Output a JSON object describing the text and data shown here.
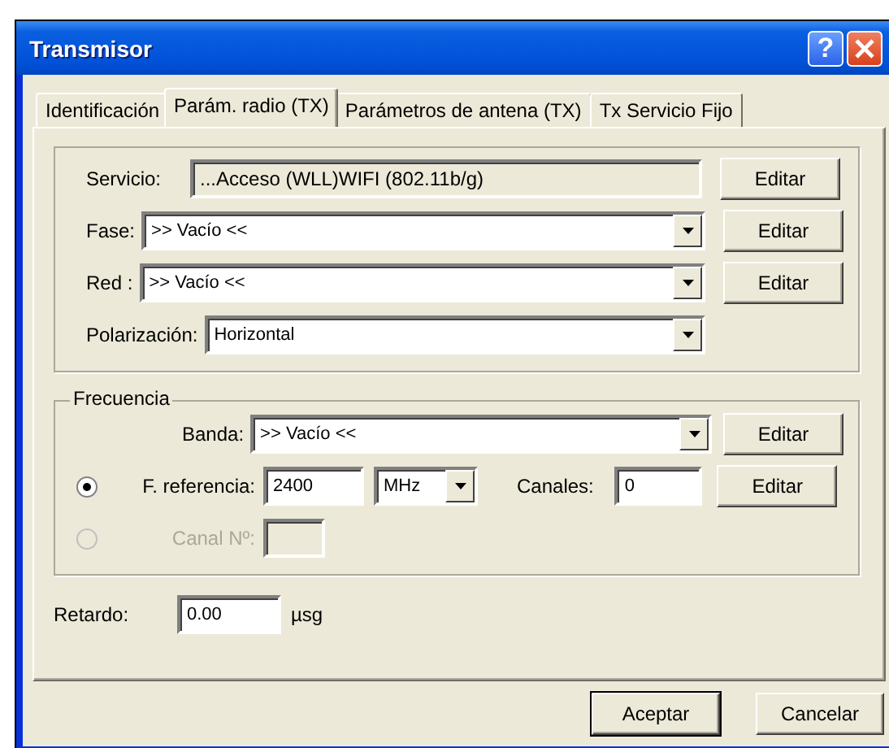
{
  "window": {
    "title": "Transmisor",
    "help": "?"
  },
  "tabs": [
    {
      "label": "Identificación",
      "selected": false
    },
    {
      "label": "Parám. radio (TX)",
      "selected": true
    },
    {
      "label": "Parámetros de antena (TX)",
      "selected": false
    },
    {
      "label": "Tx Servicio Fijo",
      "selected": false
    }
  ],
  "general": {
    "rows": [
      {
        "kind": "readonly",
        "label": "Servicio:",
        "value": "...Acceso (WLL)WIFI (802.11b/g)",
        "button": "Editar"
      },
      {
        "kind": "combo",
        "label": "Fase:",
        "value": ">> Vacío <<",
        "button": "Editar"
      },
      {
        "kind": "combo",
        "label": "Red :",
        "value": ">> Vacío <<",
        "button": "Editar"
      },
      {
        "kind": "combo",
        "label": "Polarización:",
        "value": "Horizontal"
      }
    ]
  },
  "frecuencia": {
    "title": "Frecuencia",
    "banda": {
      "label": "Banda:",
      "value": ">> Vacío <<",
      "button": "Editar"
    },
    "options": [
      {
        "label": "F. referencia:",
        "selected": true,
        "disabled": false,
        "value": "2400",
        "unit": "MHz",
        "channels_label": "Canales:",
        "channels": "0",
        "button": "Editar"
      },
      {
        "label": "Canal Nº:",
        "selected": false,
        "disabled": true
      }
    ]
  },
  "retardo": {
    "label": "Retardo:",
    "value": "0.00",
    "unit": "µsg"
  },
  "buttons": [
    {
      "label": "Aceptar",
      "default": true
    },
    {
      "label": "Cancelar",
      "default": false
    }
  ]
}
